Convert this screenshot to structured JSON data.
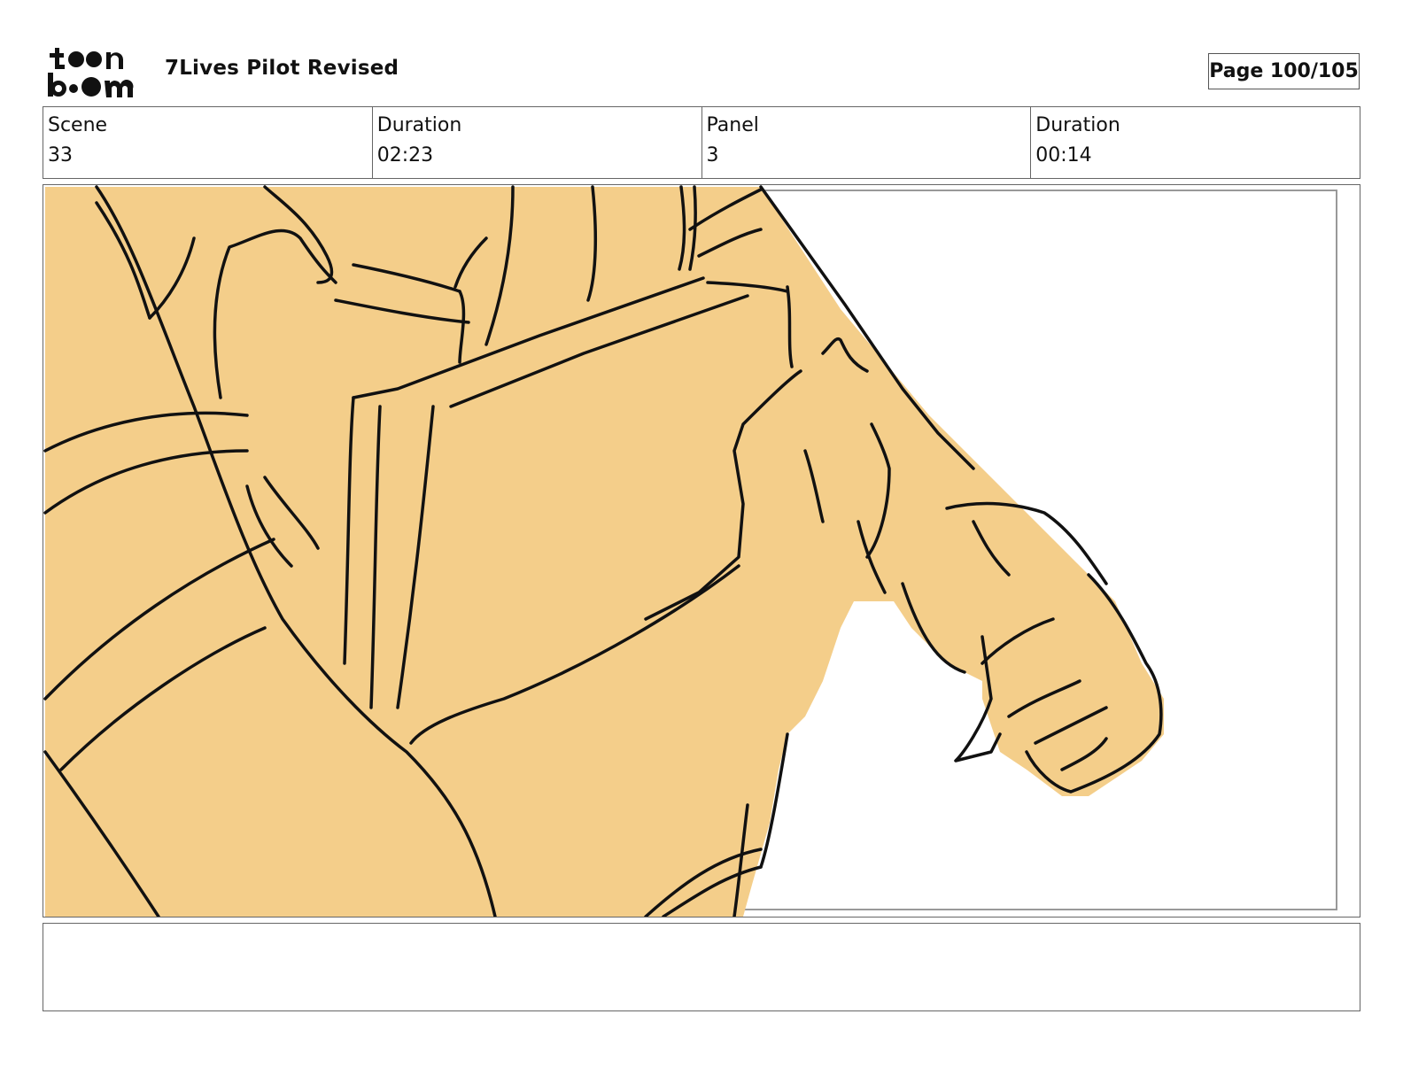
{
  "header": {
    "logo_text": "toon boom",
    "title": "7Lives Pilot Revised",
    "page_label": "Page 100/105"
  },
  "info": {
    "scene_label": "Scene",
    "scene_value": "33",
    "scene_duration_label": "Duration",
    "scene_duration_value": "02:23",
    "panel_label": "Panel",
    "panel_value": "3",
    "panel_duration_label": "Duration",
    "panel_duration_value": "00:14"
  },
  "colors": {
    "fill": "#f4ce8a",
    "ink": "#111111"
  },
  "notes": ""
}
